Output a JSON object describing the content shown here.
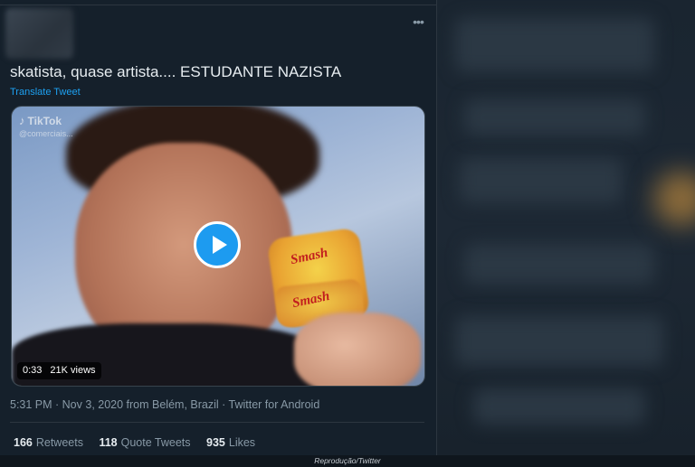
{
  "tweet": {
    "text": "skatista, quase artista.... ESTUDANTE NAZISTA",
    "translate_label": "Translate Tweet",
    "more_icon": "more-horizontal-icon",
    "video": {
      "duration": "0:33",
      "views": "21K views",
      "watermark": "TikTok",
      "watermark_handle": "@comerciais...",
      "product_label": "Smash",
      "play_icon": "play-icon"
    },
    "meta": "5:31 PM · Nov 3, 2020 from Belém, Brazil · Twitter for Android",
    "stats": {
      "retweets_count": "166",
      "retweets_label": "Retweets",
      "quotes_count": "118",
      "quotes_label": "Quote Tweets",
      "likes_count": "935",
      "likes_label": "Likes"
    }
  },
  "caption": "Reprodução/Twitter",
  "colors": {
    "background": "#15202b",
    "accent": "#1da1f2",
    "secondary_text": "#8899a6"
  }
}
